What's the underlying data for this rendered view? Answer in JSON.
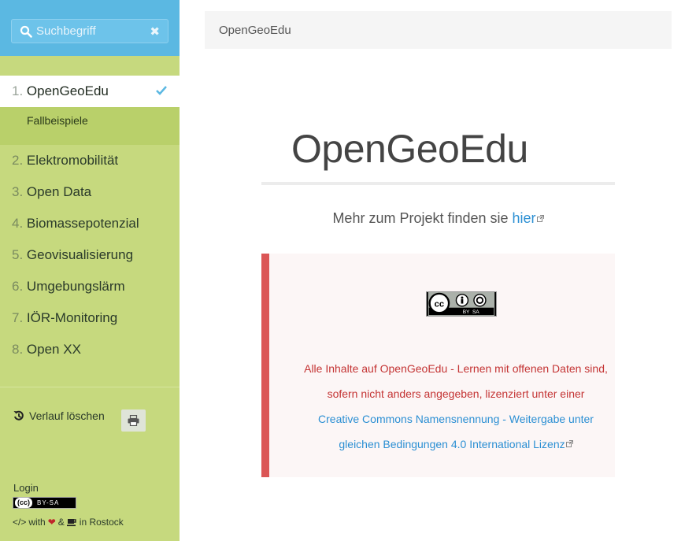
{
  "search": {
    "placeholder": "Suchbegriff",
    "icon": "search-icon",
    "clear_icon": "close-icon"
  },
  "menu": {
    "items": [
      {
        "num": "1.",
        "label": "OpenGeoEdu",
        "active": true
      },
      {
        "num": "2.",
        "label": "Elektromobilität"
      },
      {
        "num": "3.",
        "label": "Open Data"
      },
      {
        "num": "4.",
        "label": "Biomassepotenzial"
      },
      {
        "num": "5.",
        "label": "Geovisualisierung"
      },
      {
        "num": "6.",
        "label": "Umgebungslärm"
      },
      {
        "num": "7.",
        "label": "IÖR-Monitoring"
      },
      {
        "num": "8.",
        "label": "Open XX"
      }
    ],
    "sub_item": "Fallbeispiele"
  },
  "sidebar_footer": {
    "history": "Verlauf löschen",
    "login": "Login",
    "license_small": "BY-SA",
    "made_with": "with",
    "amp": "&",
    "place": "in Rostock"
  },
  "header": {
    "breadcrumb": "OpenGeoEdu"
  },
  "main": {
    "title": "OpenGeoEdu",
    "more_text": "Mehr zum Projekt finden sie ",
    "more_link": "hier",
    "license_line1": "Alle Inhalte auf OpenGeoEdu - Lernen mit offenen Daten sind,",
    "license_line2": "sofern nicht anders angegeben, lizenziert unter einer",
    "license_link1": "Creative Commons Namensnennung - Weitergabe unter",
    "license_link2": "gleichen Bedingungen 4.0 International Lizenz",
    "badge_text": "BY  SA"
  },
  "colors": {
    "sidebar": "#c6d97e",
    "sidebar_top": "#5bb8e2",
    "accent": "#2b8fd3",
    "notice_border": "#db5656",
    "notice_text": "#c43434"
  }
}
